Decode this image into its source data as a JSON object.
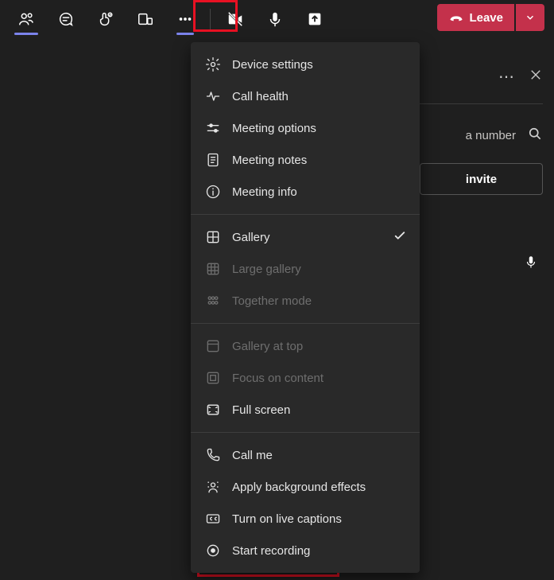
{
  "toolbar": {
    "leave_label": "Leave"
  },
  "panel": {
    "search_placeholder": "a number",
    "invite_label": "invite"
  },
  "menu": {
    "section1": [
      {
        "icon": "gear",
        "label": "Device settings"
      },
      {
        "icon": "pulse",
        "label": "Call health"
      },
      {
        "icon": "sliders",
        "label": "Meeting options"
      },
      {
        "icon": "notes",
        "label": "Meeting notes"
      },
      {
        "icon": "info",
        "label": "Meeting info"
      }
    ],
    "section2": [
      {
        "icon": "grid2",
        "label": "Gallery",
        "checked": true
      },
      {
        "icon": "grid3",
        "label": "Large gallery",
        "disabled": true
      },
      {
        "icon": "people",
        "label": "Together mode",
        "disabled": true
      }
    ],
    "section3": [
      {
        "icon": "toprow",
        "label": "Gallery at top",
        "disabled": true
      },
      {
        "icon": "focus",
        "label": "Focus on content",
        "disabled": true
      },
      {
        "icon": "fullscreen",
        "label": "Full screen"
      }
    ],
    "section4": [
      {
        "icon": "phone",
        "label": "Call me"
      },
      {
        "icon": "person-bg",
        "label": "Apply background effects"
      },
      {
        "icon": "cc",
        "label": "Turn on live captions"
      },
      {
        "icon": "record",
        "label": "Start recording"
      }
    ]
  }
}
